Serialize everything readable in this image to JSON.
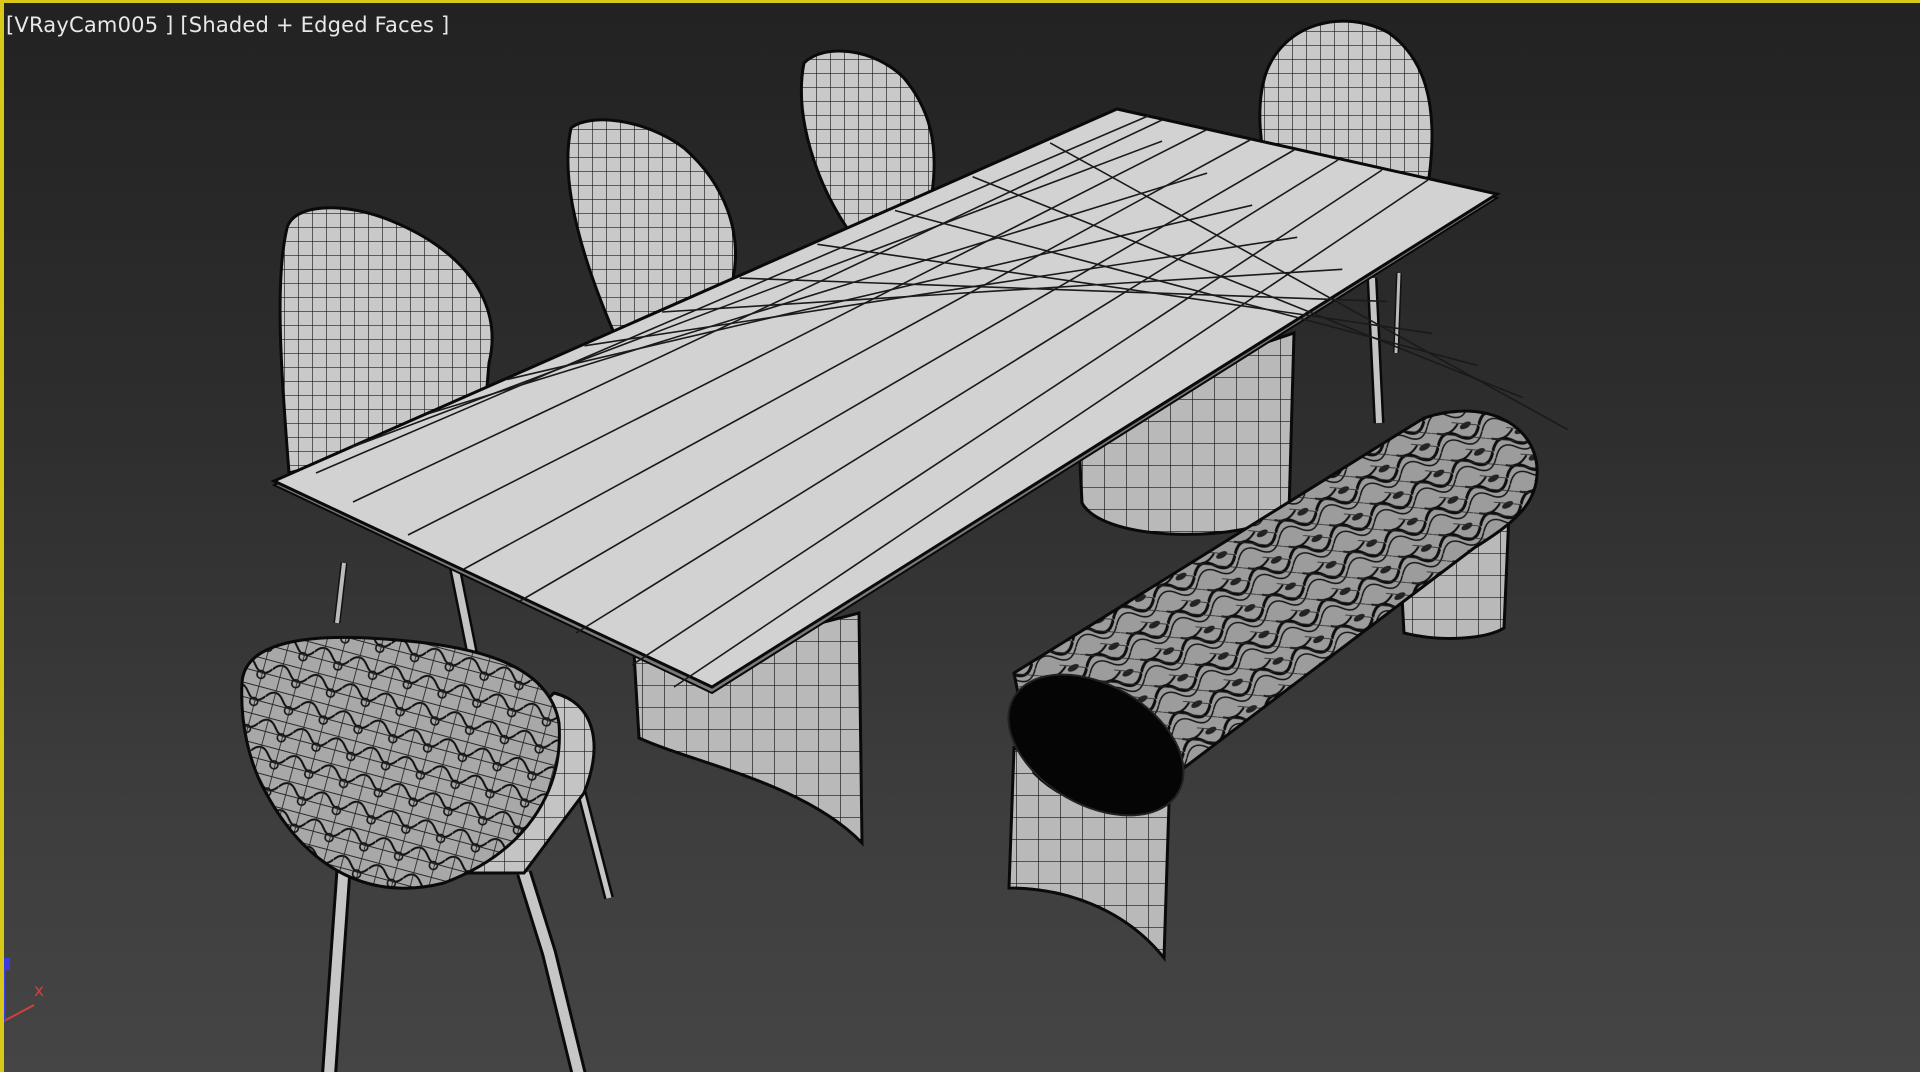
{
  "viewport": {
    "label": "[VRayCam005 ] [Shaded + Edged Faces ]",
    "active_border_color": "#d8c81a",
    "camera": "VRayCam005",
    "shading_mode": "Shaded + Edged Faces"
  },
  "axis_tripod": {
    "x_label": "x",
    "x_color": "#d04040",
    "z_color": "#3a3adf"
  },
  "scene_objects": [
    "dining-table",
    "chair-back-left",
    "chair-back-2",
    "chair-back-3",
    "chair-back-right",
    "chair-front-shell",
    "bench-cushion"
  ]
}
